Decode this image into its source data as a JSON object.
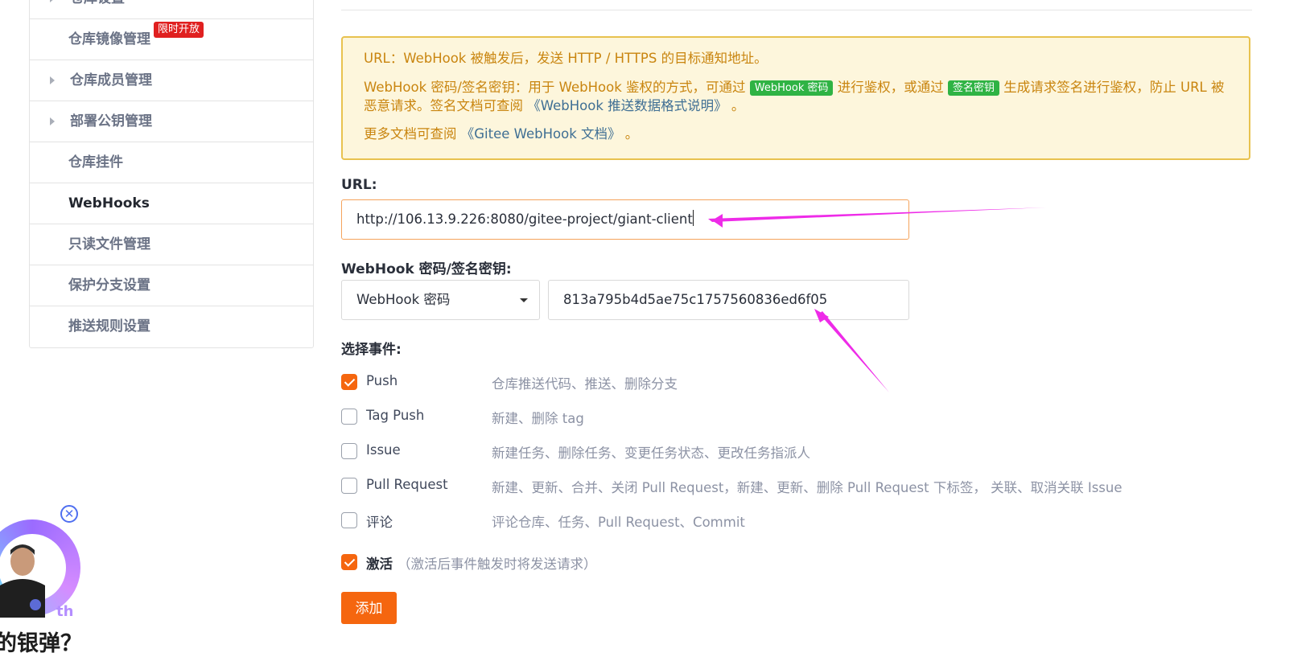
{
  "sidebar": {
    "items": [
      {
        "label": "仓库设置",
        "caret": true,
        "active": false
      },
      {
        "label": "仓库镜像管理",
        "caret": false,
        "active": false,
        "badge": "限时开放"
      },
      {
        "label": "仓库成员管理",
        "caret": true,
        "active": false
      },
      {
        "label": "部署公钥管理",
        "caret": true,
        "active": false
      },
      {
        "label": "仓库挂件",
        "caret": false,
        "active": false
      },
      {
        "label": "WebHooks",
        "caret": false,
        "active": true
      },
      {
        "label": "只读文件管理",
        "caret": false,
        "active": false
      },
      {
        "label": "保护分支设置",
        "caret": false,
        "active": false
      },
      {
        "label": "推送规则设置",
        "caret": false,
        "active": false
      }
    ]
  },
  "notice": {
    "line1": "URL：WebHook 被触发后，发送 HTTP / HTTPS 的目标通知地址。",
    "line2_a": "WebHook 密码/签名密钥：用于 WebHook 鉴权的方式，可通过",
    "chip_password": "WebHook 密码",
    "line2_b": "进行鉴权，或通过",
    "chip_sign": "签名密钥",
    "line2_c": "生成请求签名进行鉴权，防止 URL 被恶意请求。签名文档可查阅",
    "link_format": "《WebHook 推送数据格式说明》",
    "line2_d": "。",
    "line3_a": "更多文档可查阅",
    "link_docs": "《Gitee WebHook 文档》",
    "line3_b": "。"
  },
  "form": {
    "url_label": "URL:",
    "url_value": "http://106.13.9.226:8080/gitee-project/giant-client",
    "secret_label": "WebHook 密码/签名密钥:",
    "secret_type": "WebHook 密码",
    "secret_value": "813a795b4d5ae75c1757560836ed6f05",
    "events_label": "选择事件:",
    "events": [
      {
        "name": "Push",
        "desc": "仓库推送代码、推送、删除分支",
        "checked": true
      },
      {
        "name": "Tag Push",
        "desc": "新建、删除 tag",
        "checked": false
      },
      {
        "name": "Issue",
        "desc": "新建任务、删除任务、变更任务状态、更改任务指派人",
        "checked": false
      },
      {
        "name": "Pull Request",
        "desc": "新建、更新、合并、关闭 Pull Request，新建、更新、删除 Pull Request 下标签， 关联、取消关联 Issue",
        "checked": false
      },
      {
        "name": "评论",
        "desc": "评论仓库、任务、Pull Request、Commit",
        "checked": false
      }
    ],
    "activate_label": "激活",
    "activate_hint": "（激活后事件触发时将发送请求）",
    "activate_checked": true,
    "submit_label": "添加"
  },
  "overlay": {
    "caption": "的银弹？",
    "tag": "th",
    "close_symbol": "✕"
  },
  "colors": {
    "accent": "#f5660f",
    "badge_red": "#e02020",
    "chip_green": "#2fb344",
    "notice_bg": "#fdf6dc",
    "notice_text": "#c9850f",
    "annotation_arrow": "#ee2be8"
  }
}
